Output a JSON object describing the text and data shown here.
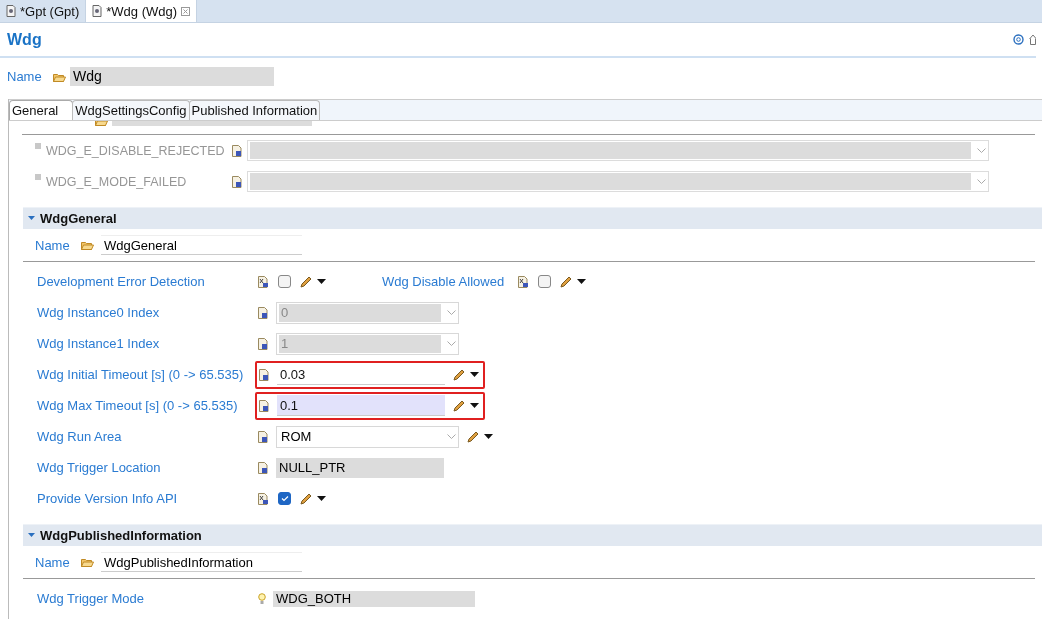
{
  "editor_tabs": [
    {
      "label": "*Gpt (Gpt)",
      "selected": false
    },
    {
      "label": "*Wdg (Wdg)",
      "selected": true
    }
  ],
  "form": {
    "title": "Wdg",
    "name_label": "Name",
    "name_value": "Wdg"
  },
  "tabs": [
    {
      "label": "General",
      "selected": true
    },
    {
      "label": "WdgSettingsConfig",
      "selected": false
    },
    {
      "label": "Published Information",
      "selected": false
    }
  ],
  "errors": [
    {
      "label": "WDG_E_DISABLE_REJECTED",
      "disabled": true
    },
    {
      "label": "WDG_E_MODE_FAILED",
      "disabled": true
    }
  ],
  "sections": [
    {
      "title": "WdgGeneral",
      "expanded": true,
      "name_label": "Name",
      "name_value": "WdgGeneral",
      "rows": [
        {
          "fields": [
            {
              "kind": "checkbox",
              "label": "Development Error Detection",
              "checked": false
            },
            {
              "kind": "checkbox",
              "label": "Wdg Disable Allowed",
              "checked": false
            }
          ]
        },
        {
          "fields": [
            {
              "kind": "combo",
              "label": "Wdg Instance0 Index",
              "value": "0",
              "disabled": true
            }
          ]
        },
        {
          "fields": [
            {
              "kind": "combo",
              "label": "Wdg Instance1 Index",
              "value": "1",
              "disabled": true
            }
          ]
        },
        {
          "fields": [
            {
              "kind": "text",
              "label": "Wdg Initial Timeout [s] (0 -> 65.535)",
              "value": "0.03",
              "highlighted": true,
              "focused": false
            }
          ]
        },
        {
          "fields": [
            {
              "kind": "text",
              "label": "Wdg Max Timeout [s] (0 -> 65.535)",
              "value": "0.1",
              "highlighted": true,
              "focused": true
            }
          ]
        },
        {
          "fields": [
            {
              "kind": "combo",
              "label": "Wdg Run Area",
              "value": "ROM",
              "disabled": false
            }
          ]
        },
        {
          "fields": [
            {
              "kind": "readonly",
              "label": "Wdg Trigger Location",
              "value": "NULL_PTR"
            }
          ]
        },
        {
          "fields": [
            {
              "kind": "checkbox",
              "label": "Provide Version Info API",
              "checked": true
            }
          ]
        }
      ]
    },
    {
      "title": "WdgPublishedInformation",
      "expanded": true,
      "name_label": "Name",
      "name_value": "WdgPublishedInformation",
      "rows": [
        {
          "fields": [
            {
              "kind": "info",
              "label": "Wdg Trigger Mode",
              "value": "WDG_BOTH"
            }
          ]
        }
      ]
    }
  ]
}
